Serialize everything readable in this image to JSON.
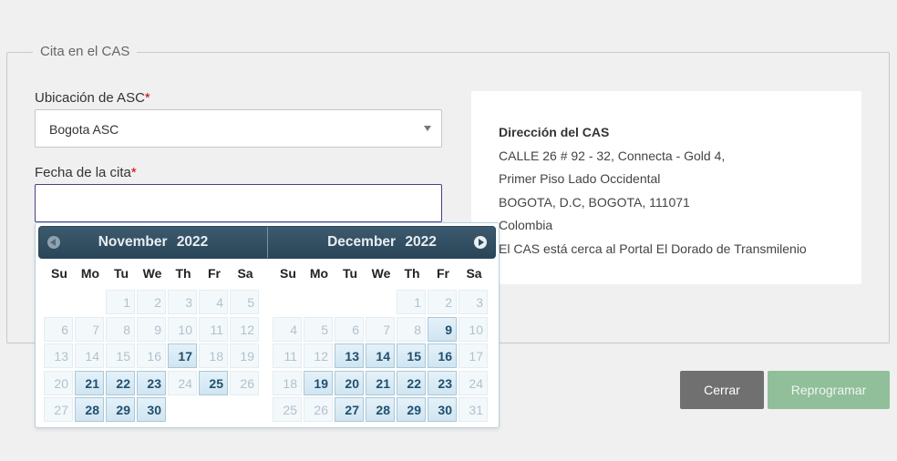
{
  "section": {
    "legend": "Cita en el CAS"
  },
  "form": {
    "location_label": "Ubicación de ASC",
    "location_value": "Bogota ASC",
    "date_label": "Fecha de la cita",
    "required_mark": "*",
    "date_value": ""
  },
  "info": {
    "title": "Dirección del CAS",
    "lines": [
      "CALLE 26 # 92 - 32, Connecta - Gold 4,",
      "Primer Piso Lado Occidental",
      "BOGOTA, D.C, BOGOTA, 111071",
      "Colombia",
      "El CAS está cerca al Portal El Dorado de Transmilenio"
    ]
  },
  "buttons": {
    "close": "Cerrar",
    "reschedule": "Reprogramar"
  },
  "datepicker": {
    "weekdays": [
      "Su",
      "Mo",
      "Tu",
      "We",
      "Th",
      "Fr",
      "Sa"
    ],
    "months": [
      {
        "name": "November",
        "year": "2022",
        "first_weekday": 2,
        "days": 30,
        "available": [
          17,
          21,
          22,
          23,
          25,
          28,
          29,
          30
        ]
      },
      {
        "name": "December",
        "year": "2022",
        "first_weekday": 4,
        "days": 31,
        "available": [
          9,
          13,
          14,
          15,
          16,
          19,
          20,
          21,
          22,
          23,
          27,
          28,
          29,
          30
        ]
      }
    ]
  },
  "colors": {
    "header_bg": "#2a4558",
    "available_day_bg": "#d0e5f1",
    "unavailable_day_text": "#b0c2cd",
    "close_button": "#707070",
    "reschedule_button": "#90bf9a"
  }
}
